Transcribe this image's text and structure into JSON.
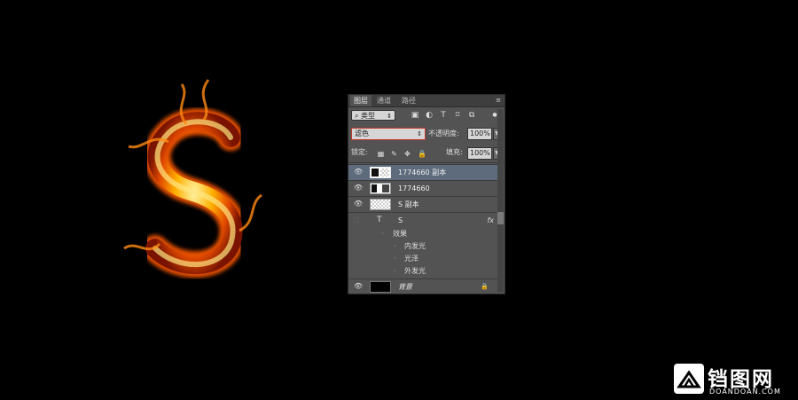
{
  "panel": {
    "tabs": [
      "图层",
      "通道",
      "路径"
    ],
    "filter": {
      "label": "⌕ 类型"
    },
    "blend_mode": "滤色",
    "opacity_label": "不透明度:",
    "opacity_value": "100%",
    "lock_label": "锁定:",
    "fill_label": "填充:",
    "fill_value": "100%",
    "layers": [
      {
        "name": "1774660 副本",
        "selected": true,
        "visible": true,
        "thumb": "mixed"
      },
      {
        "name": "1774660",
        "selected": false,
        "visible": true,
        "thumb": "mixed"
      },
      {
        "name": "S 副本",
        "selected": false,
        "visible": true,
        "thumb": "transparent"
      },
      {
        "name": "S",
        "type": "text",
        "visible": false,
        "has_fx": true
      },
      {
        "name": "背景",
        "selected": false,
        "visible": true,
        "thumb": "black",
        "locked": true
      }
    ],
    "effects_label": "效果",
    "effects": [
      "内发光",
      "光泽",
      "外发光"
    ],
    "fx_badge": "fx",
    "text_layer_icon": "T"
  },
  "watermark": {
    "cn": "铛图网",
    "en": "DOANDOAN.COM"
  }
}
